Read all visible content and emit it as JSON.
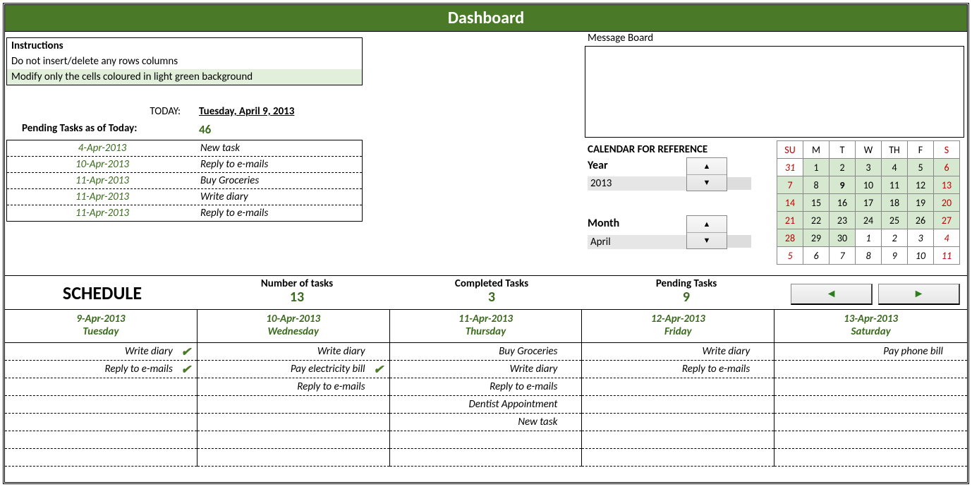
{
  "title": "Dashboard",
  "instructions": {
    "header": "Instructions",
    "line1": "Do not insert/delete any rows columns",
    "line2": "Modify only the cells coloured in light green background"
  },
  "today_label": "TODAY:",
  "today_value": "Tuesday, April 9, 2013",
  "pending_label": "Pending Tasks as of Today:",
  "pending_count": "46",
  "pending_list": [
    {
      "date": "4-Apr-2013",
      "desc": "New task"
    },
    {
      "date": "10-Apr-2013",
      "desc": "Reply to e-mails"
    },
    {
      "date": "11-Apr-2013",
      "desc": "Buy Groceries"
    },
    {
      "date": "11-Apr-2013",
      "desc": "Write diary"
    },
    {
      "date": "11-Apr-2013",
      "desc": "Reply to e-mails"
    }
  ],
  "message_board_label": "Message Board",
  "calref_label": "CALENDAR FOR REFERENCE",
  "year_label": "Year",
  "year_value": "2013",
  "month_label": "Month",
  "month_value": "April",
  "mini_cal": {
    "dow": [
      "SU",
      "M",
      "T",
      "W",
      "TH",
      "F",
      "S"
    ],
    "rows": [
      [
        {
          "v": "31",
          "cls": "oth red"
        },
        {
          "v": "1",
          "cls": "cur"
        },
        {
          "v": "2",
          "cls": "cur"
        },
        {
          "v": "3",
          "cls": "cur"
        },
        {
          "v": "4",
          "cls": "cur"
        },
        {
          "v": "5",
          "cls": "cur"
        },
        {
          "v": "6",
          "cls": "cur red"
        }
      ],
      [
        {
          "v": "7",
          "cls": "cur red"
        },
        {
          "v": "8",
          "cls": "cur"
        },
        {
          "v": "9",
          "cls": "today"
        },
        {
          "v": "10",
          "cls": "cur"
        },
        {
          "v": "11",
          "cls": "cur"
        },
        {
          "v": "12",
          "cls": "cur"
        },
        {
          "v": "13",
          "cls": "cur red"
        }
      ],
      [
        {
          "v": "14",
          "cls": "cur red"
        },
        {
          "v": "15",
          "cls": "cur"
        },
        {
          "v": "16",
          "cls": "cur"
        },
        {
          "v": "17",
          "cls": "cur"
        },
        {
          "v": "18",
          "cls": "cur"
        },
        {
          "v": "19",
          "cls": "cur"
        },
        {
          "v": "20",
          "cls": "cur red"
        }
      ],
      [
        {
          "v": "21",
          "cls": "cur red"
        },
        {
          "v": "22",
          "cls": "cur"
        },
        {
          "v": "23",
          "cls": "cur"
        },
        {
          "v": "24",
          "cls": "cur"
        },
        {
          "v": "25",
          "cls": "cur"
        },
        {
          "v": "26",
          "cls": "cur"
        },
        {
          "v": "27",
          "cls": "cur red"
        }
      ],
      [
        {
          "v": "28",
          "cls": "cur red"
        },
        {
          "v": "29",
          "cls": "cur"
        },
        {
          "v": "30",
          "cls": "cur"
        },
        {
          "v": "1",
          "cls": "oth"
        },
        {
          "v": "2",
          "cls": "oth"
        },
        {
          "v": "3",
          "cls": "oth"
        },
        {
          "v": "4",
          "cls": "oth red"
        }
      ],
      [
        {
          "v": "5",
          "cls": "oth red"
        },
        {
          "v": "6",
          "cls": "oth"
        },
        {
          "v": "7",
          "cls": "oth"
        },
        {
          "v": "8",
          "cls": "oth"
        },
        {
          "v": "9",
          "cls": "oth"
        },
        {
          "v": "10",
          "cls": "oth"
        },
        {
          "v": "11",
          "cls": "oth red"
        }
      ]
    ]
  },
  "schedule_label": "SCHEDULE",
  "stats": [
    {
      "label": "Number of tasks",
      "value": "13"
    },
    {
      "label": "Completed Tasks",
      "value": "3"
    },
    {
      "label": "Pending Tasks",
      "value": "9"
    }
  ],
  "days": [
    {
      "date": "9-Apr-2013",
      "name": "Tuesday",
      "tasks": [
        {
          "t": "Write diary",
          "done": true
        },
        {
          "t": "Reply to e-mails",
          "done": true
        },
        {
          "t": ""
        },
        {
          "t": ""
        },
        {
          "t": ""
        },
        {
          "t": ""
        },
        {
          "t": ""
        }
      ]
    },
    {
      "date": "10-Apr-2013",
      "name": "Wednesday",
      "tasks": [
        {
          "t": "Write diary"
        },
        {
          "t": "Pay electricity bill",
          "done": true
        },
        {
          "t": "Reply to e-mails"
        },
        {
          "t": ""
        },
        {
          "t": ""
        },
        {
          "t": ""
        },
        {
          "t": ""
        }
      ]
    },
    {
      "date": "11-Apr-2013",
      "name": "Thursday",
      "tasks": [
        {
          "t": "Buy Groceries"
        },
        {
          "t": "Write diary"
        },
        {
          "t": "Reply to e-mails"
        },
        {
          "t": "Dentist Appointment"
        },
        {
          "t": "New task"
        },
        {
          "t": ""
        },
        {
          "t": ""
        }
      ]
    },
    {
      "date": "12-Apr-2013",
      "name": "Friday",
      "tasks": [
        {
          "t": "Write diary"
        },
        {
          "t": "Reply to e-mails"
        },
        {
          "t": ""
        },
        {
          "t": ""
        },
        {
          "t": ""
        },
        {
          "t": ""
        },
        {
          "t": ""
        }
      ]
    },
    {
      "date": "13-Apr-2013",
      "name": "Saturday",
      "tasks": [
        {
          "t": "Pay phone bill"
        },
        {
          "t": ""
        },
        {
          "t": ""
        },
        {
          "t": ""
        },
        {
          "t": ""
        },
        {
          "t": ""
        },
        {
          "t": ""
        }
      ]
    }
  ]
}
